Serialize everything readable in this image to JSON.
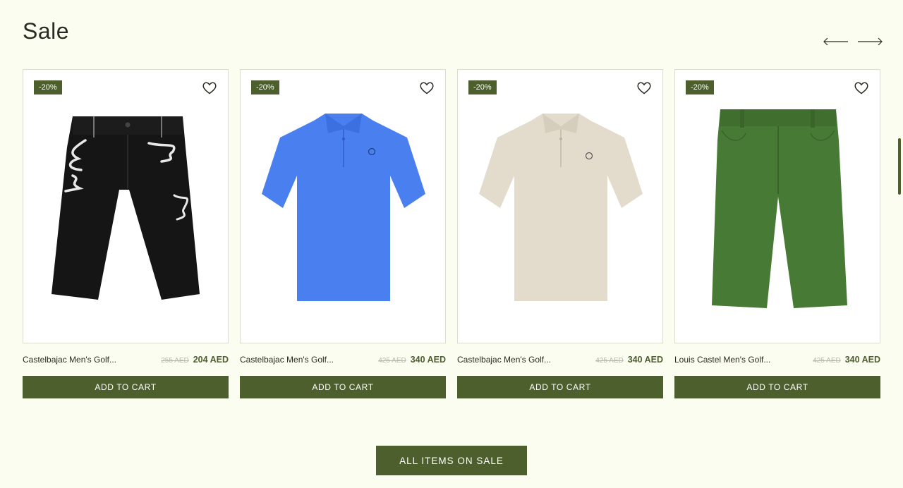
{
  "section": {
    "title": "Sale"
  },
  "nav": {
    "prev_icon": "arrow-left-icon",
    "next_icon": "arrow-right-icon"
  },
  "products": [
    {
      "badge": "-20%",
      "name": "Castelbajac Men's Golf...",
      "old_price": "255 AED",
      "new_price": "204 AED",
      "add_label": "ADD TO CART",
      "image": "black-shorts"
    },
    {
      "badge": "-20%",
      "name": "Castelbajac Men's Golf...",
      "old_price": "425 AED",
      "new_price": "340 AED",
      "add_label": "ADD TO CART",
      "image": "blue-polo"
    },
    {
      "badge": "-20%",
      "name": "Castelbajac Men's Golf...",
      "old_price": "425 AED",
      "new_price": "340 AED",
      "add_label": "ADD TO CART",
      "image": "beige-polo"
    },
    {
      "badge": "-20%",
      "name": "Louis Castel Men's Golf...",
      "old_price": "425 AED",
      "new_price": "340 AED",
      "add_label": "ADD TO CART",
      "image": "green-shorts"
    }
  ],
  "cta": {
    "label": "ALL ITEMS ON SALE"
  },
  "colors": {
    "accent": "#4c5f2d",
    "background": "#fbfdf1",
    "blue_polo": "#4a7ff0",
    "beige_polo": "#e3dccd",
    "green_shorts": "#477a34",
    "black_shorts": "#151515"
  }
}
